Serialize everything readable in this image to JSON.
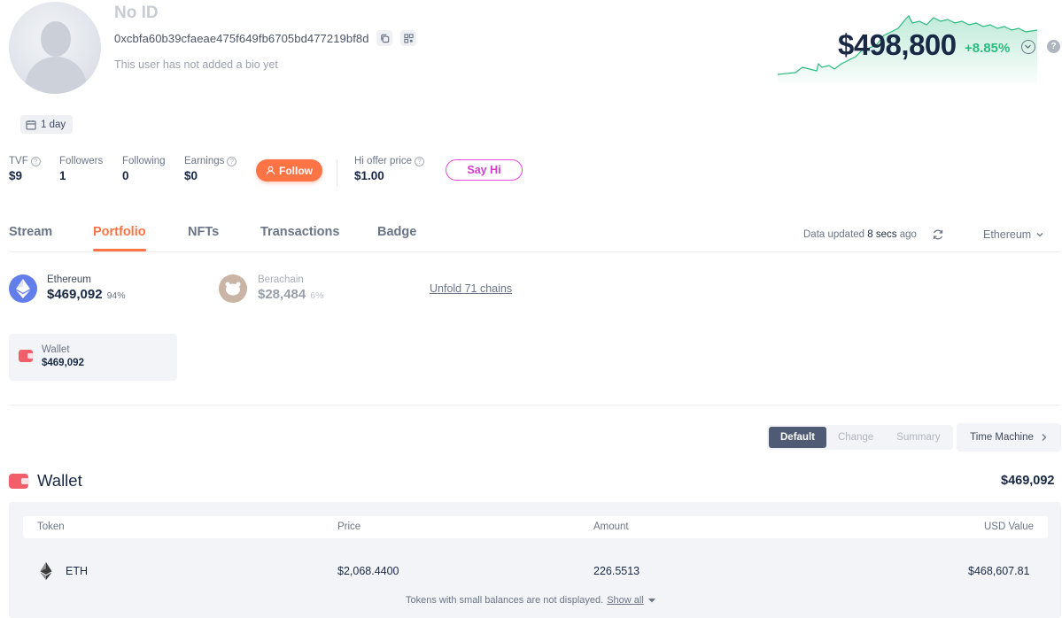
{
  "profile": {
    "name": "No ID",
    "address": "0xcbfa60b39cfaeae475f649fb6705bd477219bf8d",
    "bio": "This user has not added a bio yet",
    "age_tag": "1 day"
  },
  "stats": {
    "tvf": {
      "label": "TVF",
      "value": "$9"
    },
    "followers": {
      "label": "Followers",
      "value": "1"
    },
    "following": {
      "label": "Following",
      "value": "0"
    },
    "earnings": {
      "label": "Earnings",
      "value": "$0"
    },
    "follow_label": "Follow",
    "hi_offer": {
      "label": "Hi offer price",
      "value": "$1.00"
    },
    "say_hi_label": "Say Hi"
  },
  "networth": {
    "value": "$498,800",
    "change": "+8.85%",
    "accent": "#2abb7f"
  },
  "tabs": [
    {
      "label": "Stream"
    },
    {
      "label": "Portfolio"
    },
    {
      "label": "NFTs"
    },
    {
      "label": "Transactions"
    },
    {
      "label": "Badge"
    }
  ],
  "active_tab": "Portfolio",
  "update": {
    "prefix": "Data updated",
    "time": "8 secs",
    "suffix": "ago",
    "chain_selector": "Ethereum"
  },
  "chains": [
    {
      "name": "Ethereum",
      "value": "$469,092",
      "pct": "94%"
    },
    {
      "name": "Berachain",
      "value": "$28,484",
      "pct": "6%"
    }
  ],
  "unfold_label": "Unfold 71 chains",
  "wallet_card": {
    "label": "Wallet",
    "value": "$469,092"
  },
  "modes": [
    "Default",
    "Change",
    "Summary"
  ],
  "time_machine_label": "Time Machine",
  "wallet_section": {
    "title": "Wallet",
    "total": "$469,092",
    "columns": [
      "Token",
      "Price",
      "Amount",
      "USD Value"
    ],
    "rows": [
      {
        "token": "ETH",
        "price": "$2,068.4400",
        "amount": "226.5513",
        "usd_value": "$468,607.81"
      }
    ],
    "footnote": "Tokens with small balances are not displayed.",
    "show_all": "Show all"
  },
  "colors": {
    "brand_orange": "#ff7445",
    "say_hi_pink": "#e44bd9",
    "ethereum": "#627eea"
  }
}
